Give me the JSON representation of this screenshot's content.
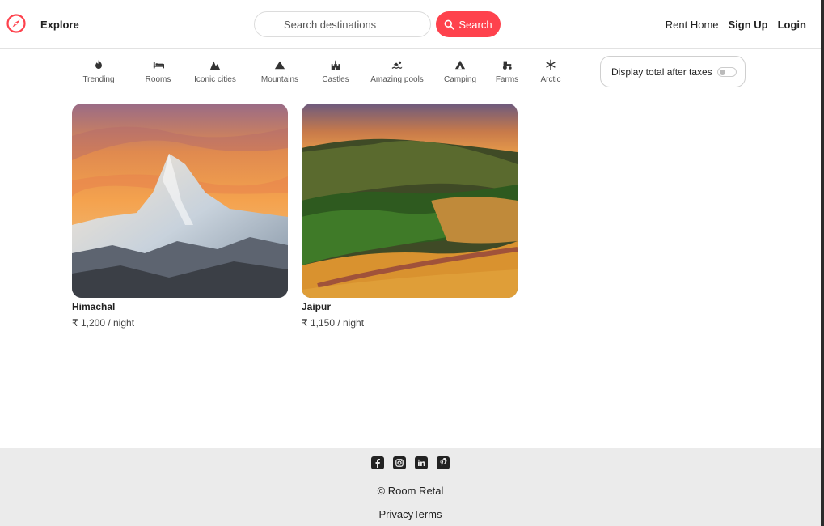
{
  "navbar": {
    "brand_icon": "compass-icon",
    "explore_label": "Explore",
    "search_placeholder": "Search destinations",
    "search_button_label": "Search",
    "rent_home_label": "Rent Home",
    "signup_label": "Sign Up",
    "login_label": "Login",
    "accent_color": "#fe424d"
  },
  "filters": [
    {
      "label": "Trending",
      "icon": "fire-icon"
    },
    {
      "label": "Rooms",
      "icon": "bed-icon"
    },
    {
      "label": "Iconic cities",
      "icon": "city-icon"
    },
    {
      "label": "Mountains",
      "icon": "mountain-icon"
    },
    {
      "label": "Castles",
      "icon": "castle-icon"
    },
    {
      "label": "Amazing pools",
      "icon": "swimmer-icon"
    },
    {
      "label": "Camping",
      "icon": "tent-icon"
    },
    {
      "label": "Farms",
      "icon": "tractor-icon"
    },
    {
      "label": "Arctic",
      "icon": "snowflake-icon"
    }
  ],
  "tax_toggle": {
    "label": "Display total after taxes",
    "enabled": false
  },
  "listings": [
    {
      "title": "Himachal",
      "price": "₹ 1,200 / night"
    },
    {
      "title": "Jaipur",
      "price": "₹ 1,150 / night"
    }
  ],
  "footer": {
    "socials": [
      "facebook-icon",
      "instagram-icon",
      "linkedin-icon",
      "pinterest-icon"
    ],
    "copyright": "© Room Retal",
    "privacy_label": "Privacy",
    "terms_label": "Terms",
    "background": "#ebebeb"
  }
}
